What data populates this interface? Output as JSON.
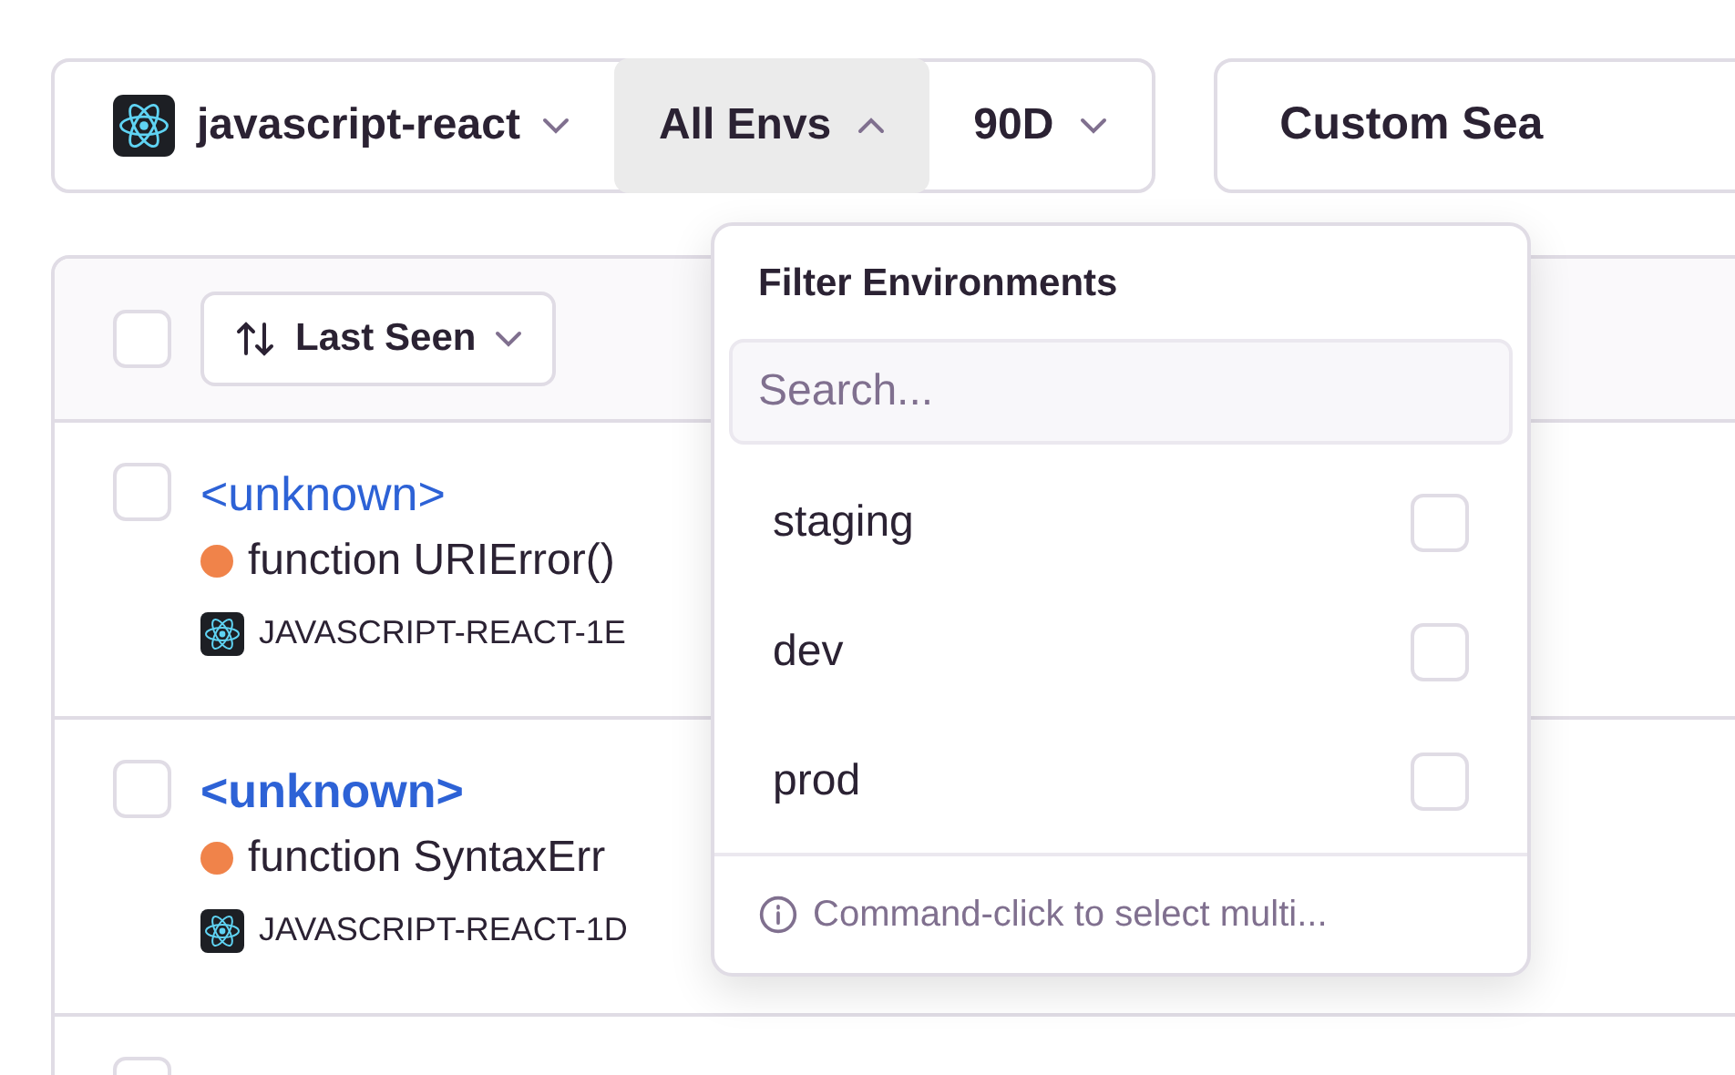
{
  "filters": {
    "project": "javascript-react",
    "environment": {
      "label": "All Envs",
      "expanded": true
    },
    "period": "90D",
    "custom_search": "Custom Sea"
  },
  "table": {
    "header": {
      "checked": false,
      "sort": "Last Seen"
    },
    "rows": [
      {
        "checked": false,
        "title": "<unknown>",
        "seen": true,
        "message": "function URIError()",
        "id": "JAVASCRIPT-REACT-1E",
        "color": "#f0834a"
      },
      {
        "checked": false,
        "title": "<unknown>",
        "seen": false,
        "message": "function SyntaxErr",
        "id": "JAVASCRIPT-REACT-1D",
        "color": "#f0834a"
      },
      {
        "checked": false
      }
    ]
  },
  "env_menu": {
    "title": "Filter Environments",
    "search": {
      "placeholder": "Search..."
    },
    "options": [
      {
        "label": "staging",
        "checked": false
      },
      {
        "label": "dev",
        "checked": false
      },
      {
        "label": "prod",
        "checked": false
      }
    ],
    "footer": "Command-click to select multi..."
  }
}
